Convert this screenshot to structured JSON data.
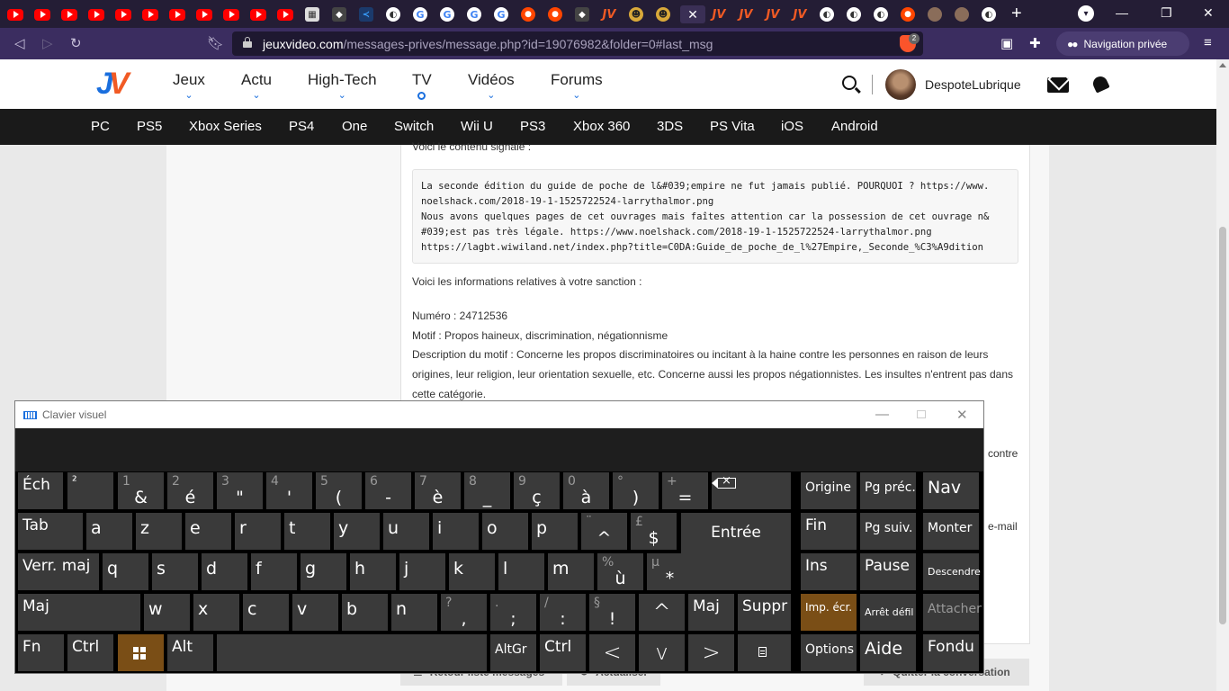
{
  "browser": {
    "tabs_favicons": [
      "yt",
      "yt",
      "yt",
      "yt",
      "yt",
      "yt",
      "yt",
      "yt",
      "yt",
      "yt",
      "yt",
      "gh",
      "dk",
      "bl",
      "wh",
      "g",
      "g",
      "g",
      "g",
      "rd",
      "rd",
      "dk",
      "jv",
      "em",
      "em",
      "active",
      "jv",
      "jv",
      "jv",
      "jv",
      "wh",
      "wh",
      "wh",
      "rd",
      "ph",
      "ph",
      "wh"
    ],
    "active_tab_close": "✕",
    "new_tab": "+",
    "url_host": "jeuxvideo.com",
    "url_path": "/messages-prives/message.php?id=19076982&folder=0#last_msg",
    "shield_count": "2",
    "private_label": "Navigation privée"
  },
  "site": {
    "logo_j": "J",
    "logo_v": "V",
    "nav": [
      {
        "label": "Jeux",
        "marker": "chevron"
      },
      {
        "label": "Actu",
        "marker": "chevron"
      },
      {
        "label": "High-Tech",
        "marker": "chevron"
      },
      {
        "label": "TV",
        "marker": "dot"
      },
      {
        "label": "Vidéos",
        "marker": "chevron"
      },
      {
        "label": "Forums",
        "marker": "chevron"
      }
    ],
    "username": "DespoteLubrique",
    "platforms": [
      "PC",
      "PS5",
      "Xbox Series",
      "PS4",
      "One",
      "Switch",
      "Wii U",
      "PS3",
      "Xbox 360",
      "3DS",
      "PS Vita",
      "iOS",
      "Android"
    ]
  },
  "message": {
    "intro": "Voici le contenu signalé :",
    "quote_lines": [
      "La seconde édition du guide de poche de l&#039;empire ne fut jamais publié. POURQUOI ? https://www.",
      "noelshack.com/2018-19-1-1525722524-larrythalmor.png",
      "Nous avons quelques pages de cet ouvrages mais faîtes attention car la possession de cet ouvrage n&",
      "#039;est pas très légale. https://www.noelshack.com/2018-19-1-1525722524-larrythalmor.png",
      "https://lagbt.wiwiland.net/index.php?title=C0DA:Guide_de_poche_de_l%27Empire,_Seconde_%C3%A9dition"
    ],
    "sanction_heading": "Voici les informations relatives à votre sanction :",
    "numero": "Numéro : 24712536",
    "motif": "Motif : Propos haineux, discrimination, négationnisme",
    "description": "Description du motif : Concerne les propos discriminatoires ou incitant à la haine contre les personnes en raison de leurs origines, leur religion, leur orientation sexuelle, etc. Concerne aussi les propos négationnistes. Les insultes n'entrent pas dans cette catégorie.",
    "partial_right_1": "contre",
    "partial_right_2": "e-mail",
    "bottom_buttons": [
      "Retour liste messages",
      "Actualiser",
      "Quitter la conversation"
    ]
  },
  "osk": {
    "title": "Clavier visuel",
    "minimize": "—",
    "close": "✕",
    "keys": {
      "ech": "Éch",
      "sup2": "²",
      "n1_sub": "1",
      "n1": "&",
      "n2_sub": "2",
      "n2": "é",
      "n3_sub": "3",
      "n3": "\"",
      "n4_sub": "4",
      "n4": "'",
      "n5_sub": "5",
      "n5": "(",
      "n6_sub": "6",
      "n6": "-",
      "n7_sub": "7",
      "n7": "è",
      "n8_sub": "8",
      "n8": "_",
      "n9_sub": "9",
      "n9": "ç",
      "n0_sub": "0",
      "n0": "à",
      "deg_sub": "°",
      "deg": ")",
      "plus_sub": "+",
      "plus": "=",
      "tab": "Tab",
      "a": "a",
      "z": "z",
      "e": "e",
      "r": "r",
      "t": "t",
      "y": "y",
      "u": "u",
      "i": "i",
      "o": "o",
      "p": "p",
      "trema_sub": "¨",
      "trema": "^",
      "pound_sub": "£",
      "pound": "$",
      "entree": "Entrée",
      "verr": "Verr. maj",
      "q": "q",
      "s": "s",
      "d": "d",
      "f": "f",
      "g": "g",
      "h": "h",
      "j": "j",
      "k": "k",
      "l": "l",
      "m": "m",
      "pct_sub": "%",
      "pct": "ù",
      "mu_sub": "µ",
      "mu": "*",
      "maj": "Maj",
      "w": "w",
      "x": "x",
      "c": "c",
      "v": "v",
      "b": "b",
      "n": "n",
      "q_sub": "?",
      "q_main": ",",
      "dot_sub": ".",
      "dot_main": ";",
      "slash_sub": "/",
      "slash_main": ":",
      "sect_sub": "§",
      "sect_main": "!",
      "up": "^",
      "maj_r": "Maj",
      "suppr": "Suppr",
      "fn": "Fn",
      "ctrl": "Ctrl",
      "alt": "Alt",
      "altgr": "AltGr",
      "ctrl_r": "Ctrl",
      "left": "<",
      "down": "v",
      "right": ">",
      "origine": "Origine",
      "pgprec": "Pg préc.",
      "nav": "Nav",
      "fin": "Fin",
      "pgsuiv": "Pg suiv.",
      "monter": "Monter",
      "ins": "Ins",
      "pause": "Pause",
      "descendre": "Descendre",
      "impecr": "Imp. écr.",
      "arretdefil": "Arrêt défil",
      "attacher": "Attacher",
      "options": "Options",
      "aide": "Aide",
      "fondu": "Fondu"
    }
  }
}
